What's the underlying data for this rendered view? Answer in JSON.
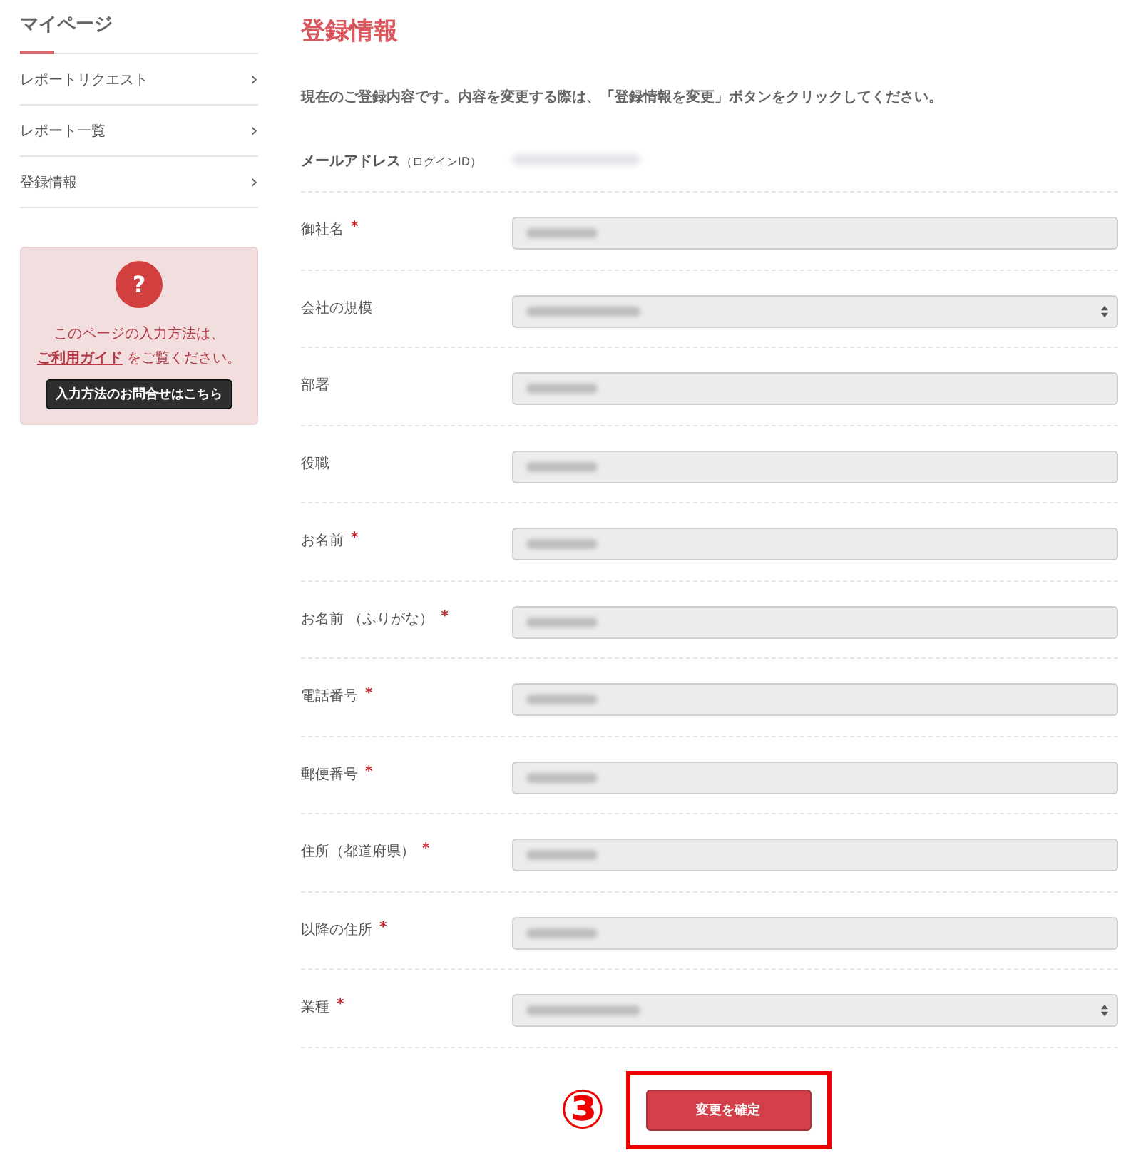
{
  "sidebar": {
    "title": "マイページ",
    "items": [
      {
        "label": "レポートリクエスト",
        "chevron": "›"
      },
      {
        "label": "レポート一覧",
        "chevron": "›"
      },
      {
        "label": "登録情報",
        "chevron": "›"
      }
    ],
    "help": {
      "icon": "?",
      "text_before": "このページの入力方法は、",
      "link": "ご利用ガイド",
      "text_after": " をご覧ください。",
      "button": "入力方法のお問合せはこちら"
    }
  },
  "main": {
    "title": "登録情報",
    "intro": "現在のご登録内容です。内容を変更する際は、「登録情報を変更」ボタンをクリックしてください。",
    "email": {
      "label": "メールアドレス",
      "sublabel": "（ログインID）"
    },
    "fields": [
      {
        "label": "御社名",
        "required": true,
        "kind": "text"
      },
      {
        "label": "会社の規模",
        "required": false,
        "kind": "select"
      },
      {
        "label": "部署",
        "required": false,
        "kind": "text"
      },
      {
        "label": "役職",
        "required": false,
        "kind": "text"
      },
      {
        "label": "お名前",
        "required": true,
        "kind": "text"
      },
      {
        "label": "お名前 （ふりがな）",
        "required": true,
        "kind": "text"
      },
      {
        "label": "電話番号",
        "required": true,
        "kind": "text"
      },
      {
        "label": "郵便番号",
        "required": true,
        "kind": "text"
      },
      {
        "label": "住所（都道府県）",
        "required": true,
        "kind": "text"
      },
      {
        "label": "以降の住所",
        "required": true,
        "kind": "text"
      },
      {
        "label": "業種",
        "required": true,
        "kind": "select"
      }
    ],
    "required_mark": "*",
    "submit": "変更を確定",
    "annotation": "③"
  }
}
